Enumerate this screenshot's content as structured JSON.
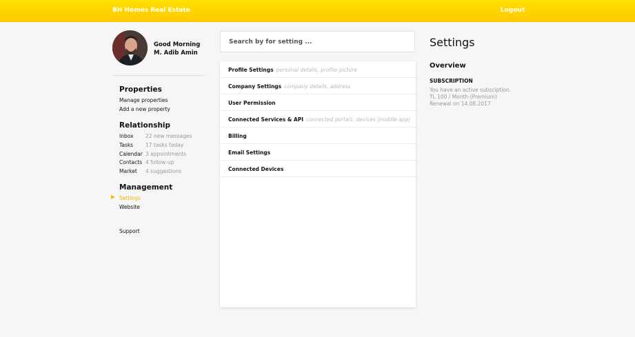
{
  "header": {
    "brand": "BH Homes Real Estate",
    "logout_label": "Logout"
  },
  "user": {
    "greeting": "Good Morning",
    "name": "M. Adib Amin"
  },
  "sidebar": {
    "properties": {
      "title": "Properties",
      "items": [
        {
          "label": "Manage properties"
        },
        {
          "label": "Add a new property"
        }
      ]
    },
    "relationship": {
      "title": "Relationship",
      "items": [
        {
          "label": "Inbox",
          "note": "22 new messages"
        },
        {
          "label": "Tasks",
          "note": "17 tasks today"
        },
        {
          "label": "Calendar",
          "note": "3 appointments"
        },
        {
          "label": "Contacts",
          "note": "4 follow-up"
        },
        {
          "label": "Market",
          "note": "4 suggestions"
        }
      ]
    },
    "management": {
      "title": "Management",
      "items": [
        {
          "label": "Settings",
          "active": true
        },
        {
          "label": "Website"
        }
      ]
    },
    "support_label": "Support"
  },
  "search": {
    "placeholder": "Search by for setting ..."
  },
  "settings_list": [
    {
      "label": "Profile Settings",
      "hint": "personal details, profile picture"
    },
    {
      "label": "Company Settings",
      "hint": "company details, address"
    },
    {
      "label": "User Permission",
      "hint": ""
    },
    {
      "label": "Connected Services & API",
      "hint": "connected portals, devices (mobile app)"
    },
    {
      "label": "Billing",
      "hint": ""
    },
    {
      "label": "Email Settings",
      "hint": ""
    },
    {
      "label": "Connected Devices",
      "hint": ""
    }
  ],
  "panel": {
    "title": "Settings",
    "overview": "Overview",
    "subscription_heading": "SUBSCRIPTION",
    "subscription_lines": [
      "You have an active subsciption.",
      "TL 100 / Month (Premium)",
      "Renewal on 14.08.2017"
    ]
  },
  "colors": {
    "header_top": "#ffe000",
    "header_bottom": "#ffc800",
    "accent": "#f0b400"
  }
}
